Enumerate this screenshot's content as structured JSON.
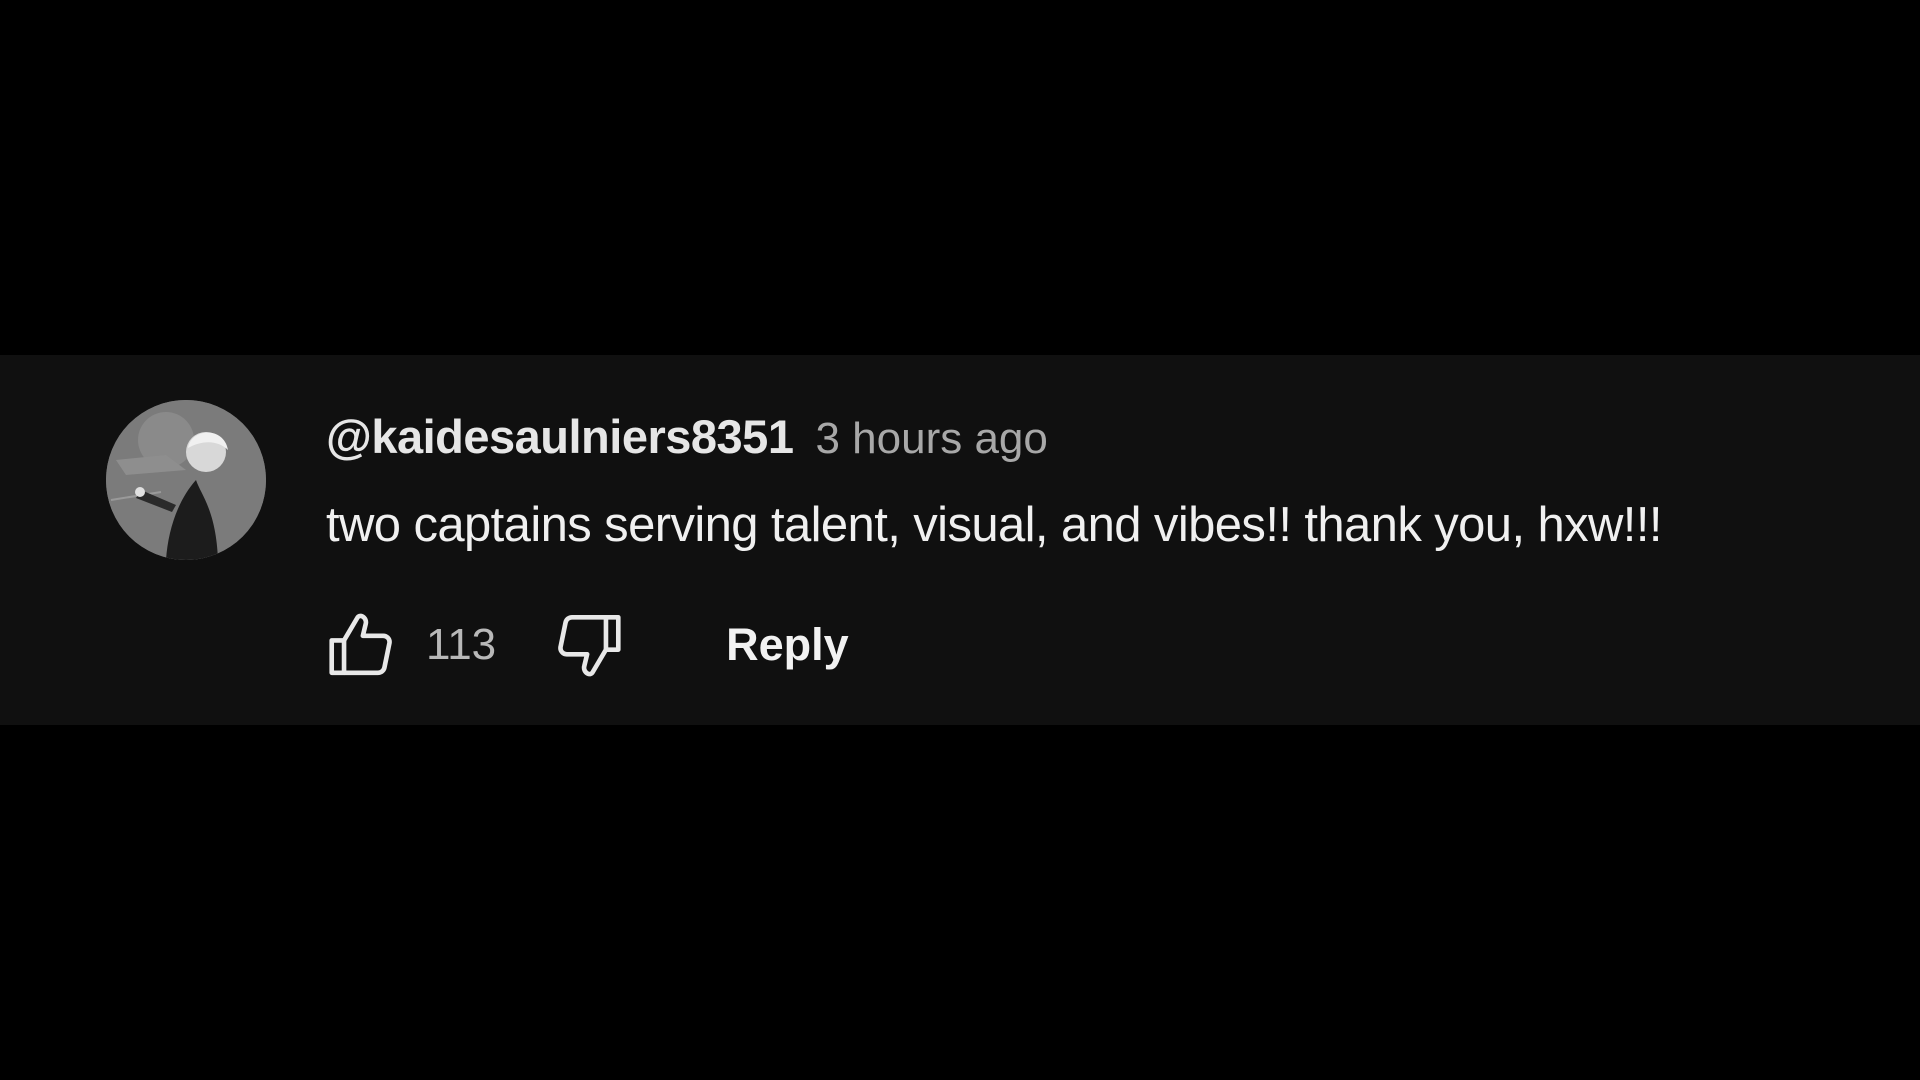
{
  "comment": {
    "author": "@kaidesaulniers8351",
    "timestamp": "3 hours ago",
    "text": "two captains serving talent, visual, and vibes!! thank you, hxw!!!",
    "like_count": "113",
    "reply_label": "Reply"
  },
  "icons": {
    "like": "thumbs-up-icon",
    "dislike": "thumbs-down-icon"
  },
  "colors": {
    "page_background": "#000000",
    "card_background": "#101010",
    "author_text": "#e6e6e6",
    "timestamp_text": "#a8a8a8",
    "comment_text": "#f0f0f0"
  }
}
